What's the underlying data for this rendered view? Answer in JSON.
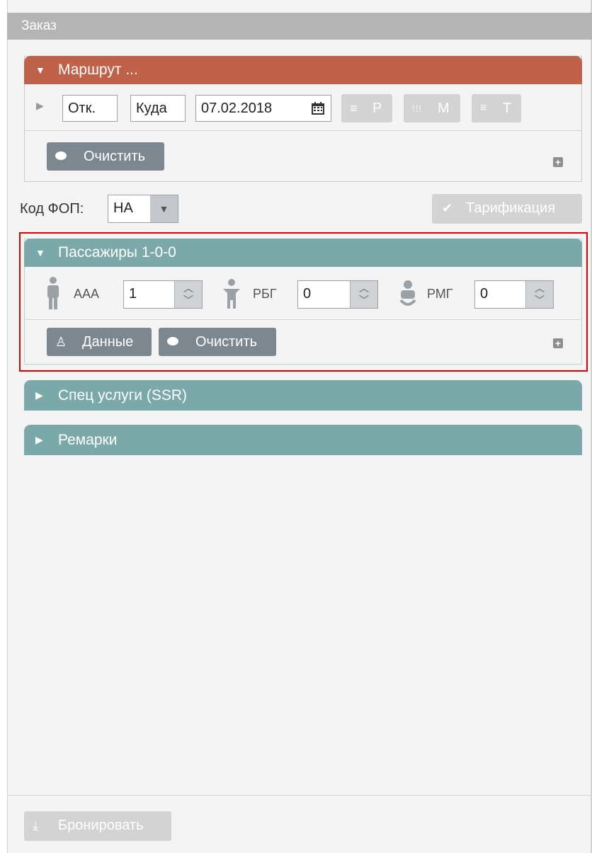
{
  "panel": {
    "title": "Заказ"
  },
  "route": {
    "title": "Маршрут ...",
    "from_value": "Отк.",
    "to_value": "Куда",
    "date_value": "07.02.2018",
    "btn_p": "Р",
    "btn_m": "М",
    "btn_t": "Т",
    "clear_label": "Очистить"
  },
  "fop": {
    "label": "Код ФОП:",
    "value": "НА",
    "tariff_label": "Тарификация"
  },
  "passengers": {
    "title": "Пассажиры 1-0-0",
    "adult_label": "ААА",
    "adult_value": "1",
    "child_label": "РБГ",
    "child_value": "0",
    "infant_label": "РМГ",
    "infant_value": "0",
    "data_label": "Данные",
    "clear_label": "Очистить"
  },
  "ssr": {
    "title": "Спец услуги (SSR)"
  },
  "remarks": {
    "title": "Ремарки"
  },
  "footer": {
    "book_label": "Бронировать"
  },
  "colors": {
    "route_header": "#c0614a",
    "teal_header": "#7ba9a9",
    "highlight_border": "#e00000"
  }
}
